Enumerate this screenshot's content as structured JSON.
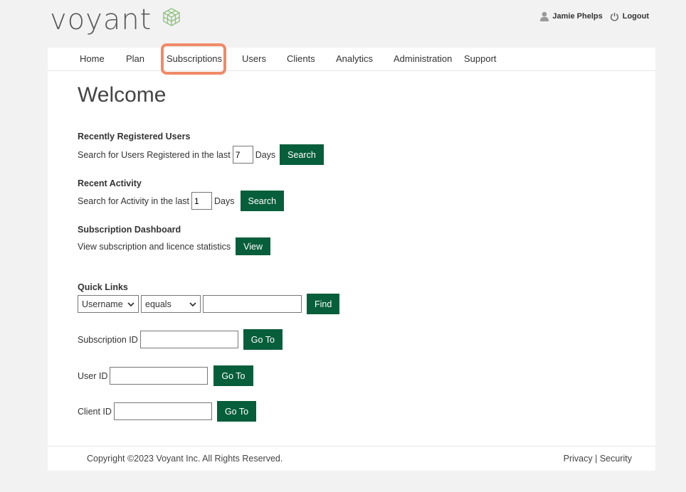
{
  "brand": {
    "name": "voyant",
    "accent": "#075e3b",
    "logo_color": "#8fc27f",
    "highlight": "#f08a67"
  },
  "user": {
    "name": "Jamie Phelps",
    "logout_label": "Logout",
    "user_icon": "user-icon",
    "logout_icon": "power-icon"
  },
  "nav": {
    "items": [
      "Home",
      "Plan",
      "Subscriptions",
      "Users",
      "Clients",
      "Analytics",
      "Administration",
      "Support"
    ],
    "highlighted": "Subscriptions"
  },
  "page": {
    "title": "Welcome"
  },
  "recent_users": {
    "heading": "Recently Registered Users",
    "text_before": "Search for Users Registered in the last",
    "value": "7",
    "text_after": "Days",
    "button": "Search"
  },
  "recent_activity": {
    "heading": "Recent Activity",
    "text_before": "Search for Activity in the last",
    "value": "1",
    "text_after": "Days",
    "button": "Search"
  },
  "dashboard": {
    "heading": "Subscription Dashboard",
    "text": "View subscription and licence statistics",
    "button": "View"
  },
  "quick_links": {
    "heading": "Quick Links",
    "field_select": "Username",
    "operator_select": "equals",
    "find_button": "Find",
    "subscription_label": "Subscription ID",
    "user_label": "User ID",
    "client_label": "Client ID",
    "goto_button": "Go To"
  },
  "footer": {
    "copyright": "Copyright ©2023 Voyant Inc. All Rights Reserved.",
    "privacy": "Privacy",
    "divider": "|",
    "security": "Security"
  }
}
